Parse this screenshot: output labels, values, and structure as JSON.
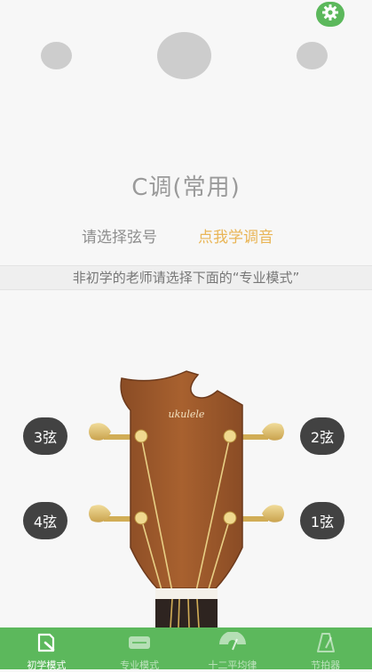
{
  "header": {
    "settings_icon": "gear-icon",
    "accent_color": "#5cb85c"
  },
  "tuner": {
    "key_title": "C调(常用)",
    "select_prompt": "请选择弦号",
    "learn_link": "点我学调音",
    "hint": "非初学的老师请选择下面的“专业模式”"
  },
  "strings": {
    "s3": "3弦",
    "s2": "2弦",
    "s4": "4弦",
    "s1": "1弦"
  },
  "headstock": {
    "logo": "ukulele"
  },
  "tabs": [
    {
      "label": "初学模式",
      "icon": "beginner-icon"
    },
    {
      "label": "专业模式",
      "icon": "pro-icon"
    },
    {
      "label": "十二平均律",
      "icon": "meter-icon"
    },
    {
      "label": "节拍器",
      "icon": "metronome-icon"
    }
  ]
}
